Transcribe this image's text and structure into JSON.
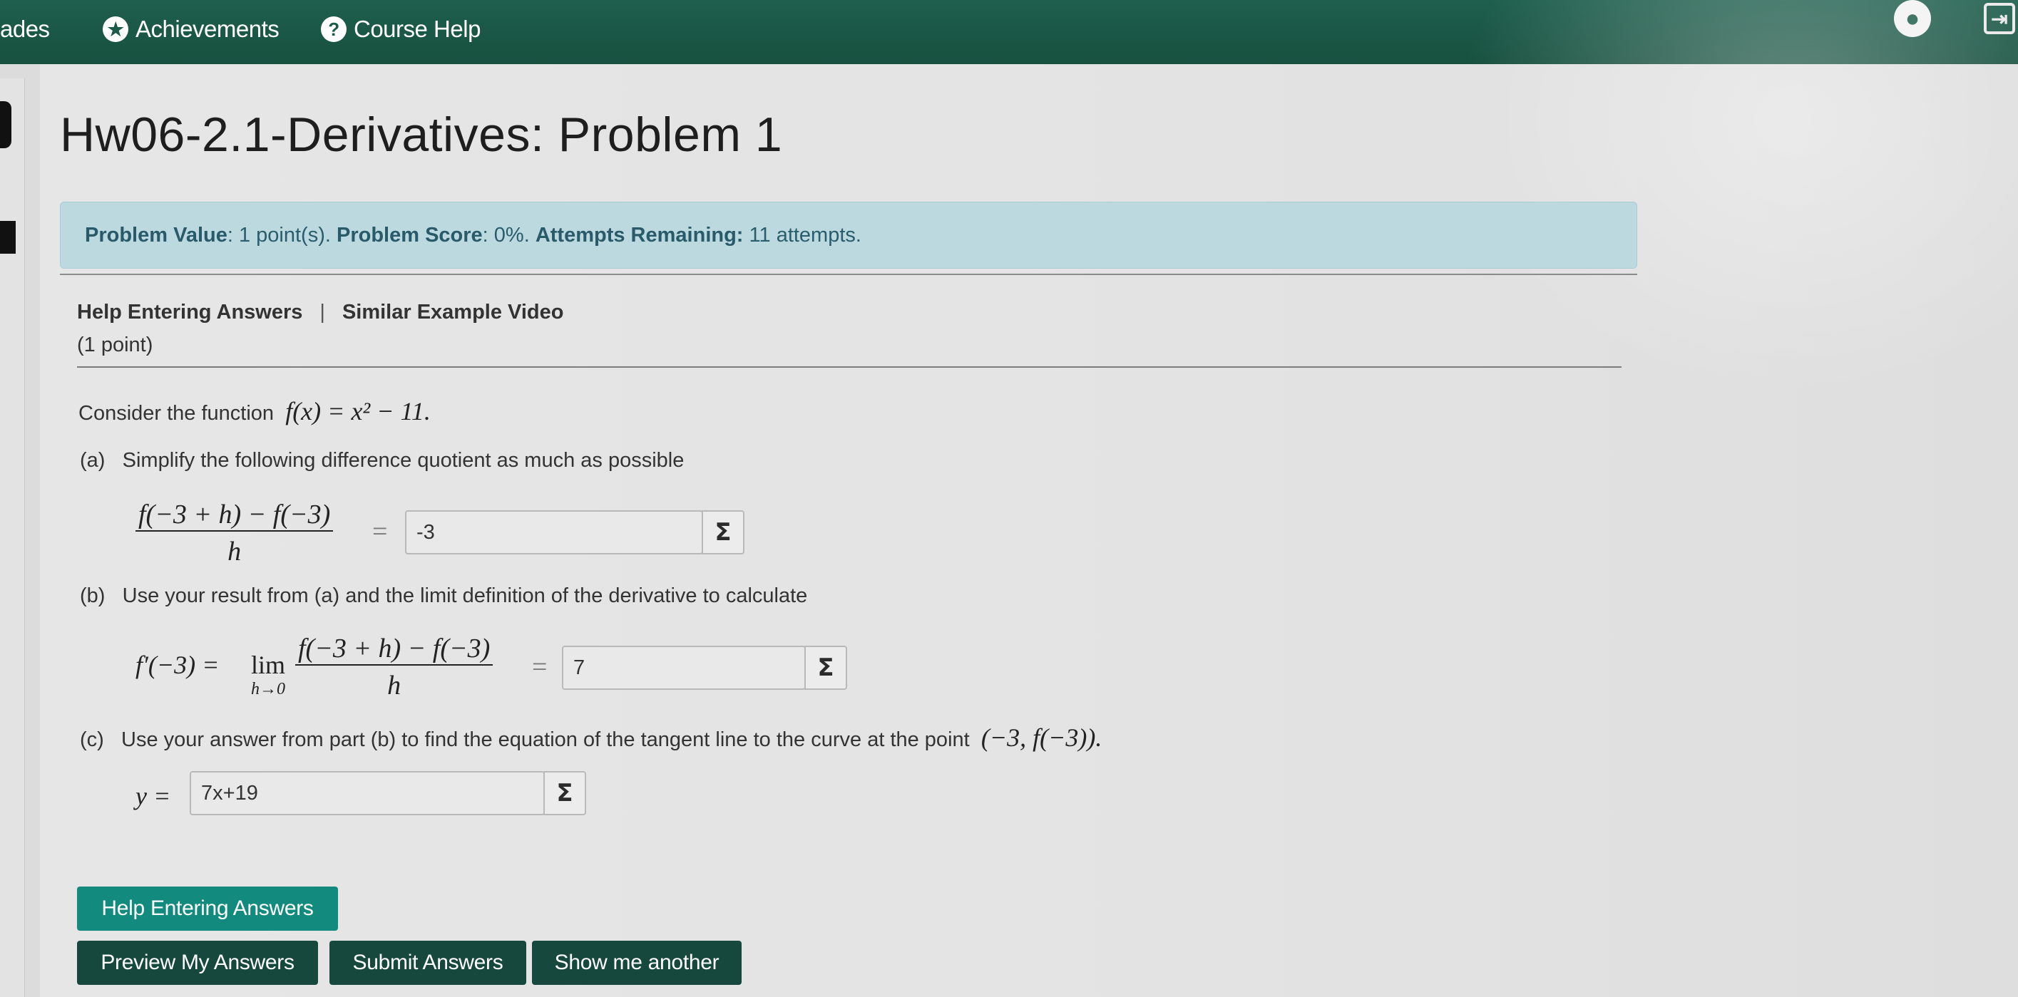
{
  "navbar": {
    "grades_label": "ades",
    "achievements_label": "Achievements",
    "course_help_label": "Course Help",
    "icons": {
      "achievements": "star-icon",
      "course_help": "question-icon",
      "user": "user-icon",
      "logout": "logout-icon"
    }
  },
  "page": {
    "title": "Hw06-2.1-Derivatives: Problem 1"
  },
  "status": {
    "value_label": "Problem Value",
    "value_text": ": 1 point(s). ",
    "score_label": "Problem Score",
    "score_text": ": 0%. ",
    "attempts_label": "Attempts Remaining:",
    "attempts_text": " 11 attempts."
  },
  "problem": {
    "help_link": "Help Entering Answers",
    "separator": "|",
    "video_link": "Similar Example Video",
    "points": "(1 point)",
    "intro_text": "Consider the function ",
    "intro_math": "f(x) = x² − 11.",
    "part_a": {
      "label": "(a)",
      "text": "Simplify the following difference quotient as much as possible",
      "numerator": "f(−3 + h) − f(−3)",
      "denominator": "h",
      "equals": "=",
      "answer": "-3"
    },
    "part_b": {
      "label": "(b)",
      "text": "Use your result from (a) and the limit definition of the derivative to calculate",
      "lhs": "f′(−3) = ",
      "lim": "lim",
      "lim_sub": "h→0",
      "numerator": "f(−3 + h) − f(−3)",
      "denominator": "h",
      "equals": "=",
      "answer": "7"
    },
    "part_c": {
      "label": "(c)",
      "text": "Use your answer from part (b) to find the equation of the tangent line to the curve at the point ",
      "point": "(−3, f(−3)).",
      "lhs": "y =",
      "answer": "7x+19"
    },
    "sigma": "Σ"
  },
  "buttons": {
    "help": "Help Entering Answers",
    "preview": "Preview My Answers",
    "submit": "Submit Answers",
    "another": "Show me another"
  },
  "colors": {
    "navbar": "#1b5a48",
    "alert_bg": "#bcd9e0",
    "alert_text": "#295d6d",
    "btn_teal": "#138a7e",
    "btn_dark": "#17483e"
  }
}
